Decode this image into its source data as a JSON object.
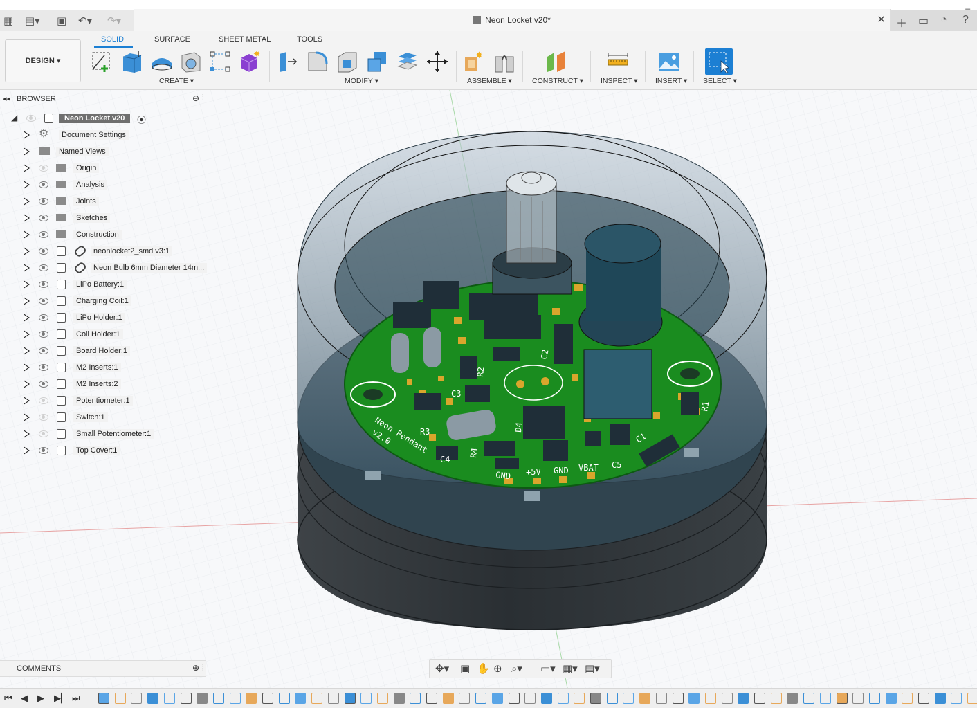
{
  "app": {
    "document_title": "Neon Locket v20*"
  },
  "toolbar": {
    "workspace_label": "DESIGN",
    "workspace_tabs": [
      "SOLID",
      "SURFACE",
      "SHEET METAL",
      "TOOLS"
    ],
    "groups": [
      "CREATE",
      "MODIFY",
      "ASSEMBLE",
      "CONSTRUCT",
      "INSPECT",
      "INSERT",
      "SELECT"
    ]
  },
  "browser": {
    "title": "BROWSER",
    "root": "Neon Locket v20",
    "items": [
      {
        "label": "Document Settings",
        "icon": "gear-icon",
        "visible": null
      },
      {
        "label": "Named Views",
        "icon": "folder-icon",
        "visible": null
      },
      {
        "label": "Origin",
        "icon": "folder-icon",
        "visible": false
      },
      {
        "label": "Analysis",
        "icon": "folder-icon",
        "visible": true
      },
      {
        "label": "Joints",
        "icon": "folder-icon",
        "visible": true
      },
      {
        "label": "Sketches",
        "icon": "folder-icon",
        "visible": true
      },
      {
        "label": "Construction",
        "icon": "folder-icon",
        "visible": true
      },
      {
        "label": "neonlocket2_smd v3:1",
        "icon": "linked-component-icon",
        "visible": true
      },
      {
        "label": "Neon Bulb 6mm Diameter 14m...",
        "icon": "linked-component-icon",
        "visible": true
      },
      {
        "label": "LiPo Battery:1",
        "icon": "component-icon",
        "visible": true
      },
      {
        "label": "Charging Coil:1",
        "icon": "component-icon",
        "visible": true
      },
      {
        "label": "LiPo Holder:1",
        "icon": "component-icon",
        "visible": true
      },
      {
        "label": "Coil Holder:1",
        "icon": "component-icon",
        "visible": true
      },
      {
        "label": "Board Holder:1",
        "icon": "component-icon",
        "visible": true
      },
      {
        "label": "M2 Inserts:1",
        "icon": "component-icon",
        "visible": true
      },
      {
        "label": "M2 Inserts:2",
        "icon": "component-icon",
        "visible": true
      },
      {
        "label": "Potentiometer:1",
        "icon": "component-icon",
        "visible": false
      },
      {
        "label": "Switch:1",
        "icon": "component-icon",
        "visible": false
      },
      {
        "label": "Small Potentiometer:1",
        "icon": "component-icon",
        "visible": false
      },
      {
        "label": "Top Cover:1",
        "icon": "component-icon",
        "visible": true
      }
    ]
  },
  "comments": {
    "title": "COMMENTS"
  },
  "pcb": {
    "silkscreen": [
      "Neon Pendant",
      "v2.0",
      "GND",
      "+5V",
      "GND",
      "VBAT",
      "C5",
      "C1",
      "C2",
      "C3",
      "C4",
      "R1",
      "R2",
      "R3",
      "R4",
      "D4"
    ]
  },
  "colors": {
    "accent": "#1c7fd3",
    "pcb_green": "#1a8c1f",
    "pad_gold": "#d9a62c",
    "enclosure": "#2b3338"
  }
}
